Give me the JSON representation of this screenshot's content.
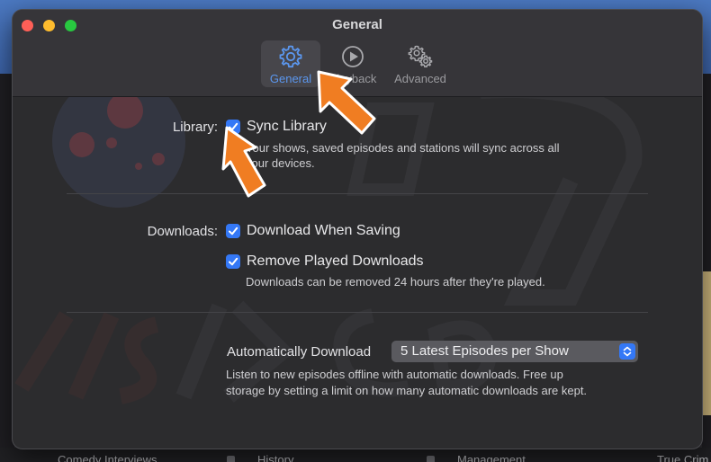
{
  "window": {
    "title": "General"
  },
  "toolbar": {
    "tabs": [
      {
        "label": "General",
        "icon": "gear-icon",
        "selected": true
      },
      {
        "label": "Playback",
        "icon": "play-circle-icon",
        "selected": false
      },
      {
        "label": "Advanced",
        "icon": "gears-icon",
        "selected": false
      }
    ]
  },
  "library": {
    "label": "Library:",
    "sync_checkbox": "Sync Library",
    "sync_checked": true,
    "help_line1": "Your shows, saved episodes and stations will sync across all",
    "help_line2": "your devices."
  },
  "downloads": {
    "label": "Downloads:",
    "download_when_saving": "Download When Saving",
    "download_when_saving_checked": true,
    "remove_played": "Remove Played Downloads",
    "remove_played_checked": true,
    "help": "Downloads can be removed 24 hours after they're played."
  },
  "auto_download": {
    "label": "Automatically Download",
    "selected_option": "5 Latest Episodes per Show",
    "help_line1": "Listen to new episodes offline with automatic downloads. Free up",
    "help_line2": "storage by setting a limit on how many automatic downloads are kept."
  },
  "background_app": {
    "bottom_items": [
      "Comedy Interviews",
      "History",
      "Management",
      "True Crim"
    ]
  },
  "colors": {
    "accent": "#3478f6",
    "selected_tab_text": "#5b97ef",
    "annotation_arrow": "#f07d22"
  }
}
